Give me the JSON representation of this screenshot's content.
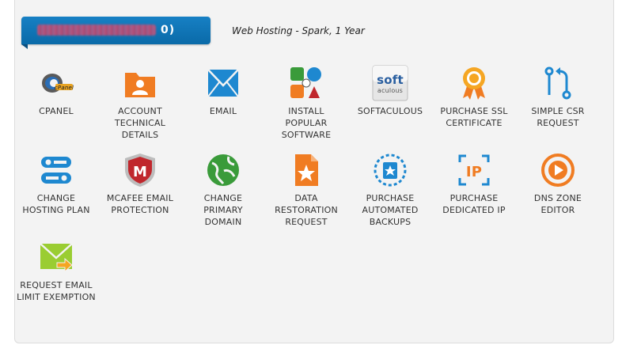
{
  "header": {
    "domain_suffix": "0)",
    "plan_text": "Web Hosting - Spark, 1 Year"
  },
  "colors": {
    "tab_blue": "#0f75b8",
    "orange": "#f07c22",
    "blue": "#1e88d0",
    "red": "#c0272d",
    "green": "#3a9b3a"
  },
  "tiles": [
    {
      "label": "CPANEL",
      "icon": "cpanel-icon"
    },
    {
      "label": "ACCOUNT TECHNICAL DETAILS",
      "icon": "account-technical-details-icon"
    },
    {
      "label": "EMAIL",
      "icon": "email-icon"
    },
    {
      "label": "INSTALL POPULAR SOFTWARE",
      "icon": "install-software-icon"
    },
    {
      "label": "SOFTACULOUS",
      "icon": "softaculous-icon",
      "icon_text": "soft",
      "icon_subtext": "aculous"
    },
    {
      "label": "PURCHASE SSL CERTIFICATE",
      "icon": "ssl-certificate-icon"
    },
    {
      "label": "SIMPLE CSR REQUEST",
      "icon": "csr-request-icon"
    },
    {
      "label": "CHANGE HOSTING PLAN",
      "icon": "change-hosting-plan-icon"
    },
    {
      "label": "MCAFEE EMAIL PROTECTION",
      "icon": "mcafee-icon",
      "icon_text": "M"
    },
    {
      "label": "CHANGE PRIMARY DOMAIN",
      "icon": "change-domain-icon"
    },
    {
      "label": "DATA RESTORATION REQUEST",
      "icon": "data-restoration-icon"
    },
    {
      "label": "PURCHASE AUTOMATED BACKUPS",
      "icon": "automated-backups-icon"
    },
    {
      "label": "PURCHASE DEDICATED IP",
      "icon": "dedicated-ip-icon",
      "icon_text": "IP"
    },
    {
      "label": "DNS ZONE EDITOR",
      "icon": "dns-zone-editor-icon"
    },
    {
      "label": "REQUEST EMAIL LIMIT EXEMPTION",
      "icon": "email-limit-icon"
    }
  ]
}
